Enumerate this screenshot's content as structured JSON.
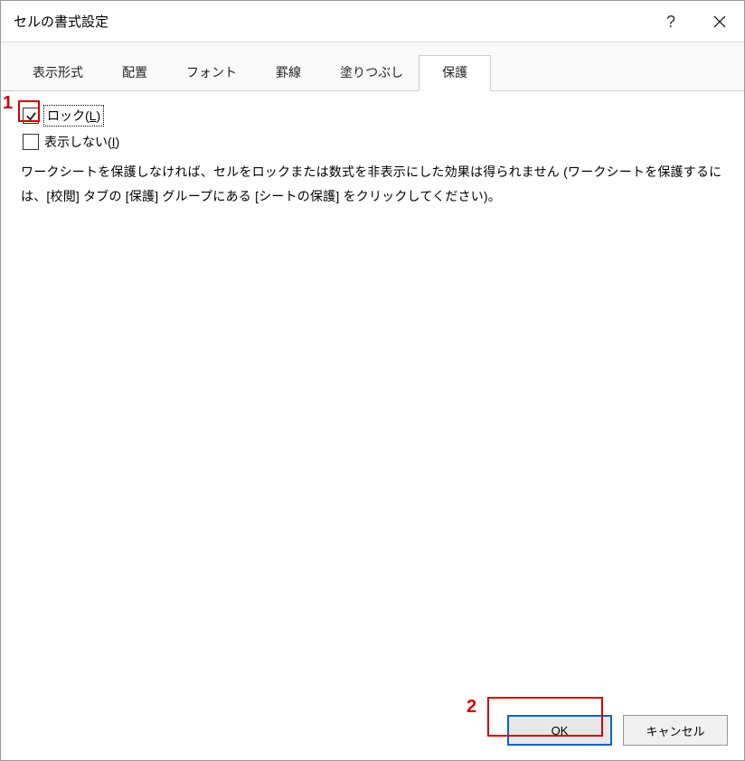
{
  "title": "セルの書式設定",
  "titlebar": {
    "help": "?",
    "close": "×"
  },
  "tabs": [
    {
      "label": "表示形式",
      "active": false
    },
    {
      "label": "配置",
      "active": false
    },
    {
      "label": "フォント",
      "active": false
    },
    {
      "label": "罫線",
      "active": false
    },
    {
      "label": "塗りつぶし",
      "active": false
    },
    {
      "label": "保護",
      "active": true
    }
  ],
  "protection": {
    "locked": {
      "label_pre": "ロック(",
      "key": "L",
      "label_post": ")",
      "checked": true,
      "focused": true
    },
    "hidden": {
      "label_pre": "表示しない(",
      "key": "I",
      "label_post": ")",
      "checked": false,
      "focused": false
    },
    "description": "ワークシートを保護しなければ、セルをロックまたは数式を非表示にした効果は得られません (ワークシートを保護するには、[校閲] タブの [保護] グループにある [シートの保護] をクリックしてください)。"
  },
  "buttons": {
    "ok": "OK",
    "cancel": "キャンセル"
  },
  "annotations": {
    "one": "1",
    "two": "2"
  }
}
